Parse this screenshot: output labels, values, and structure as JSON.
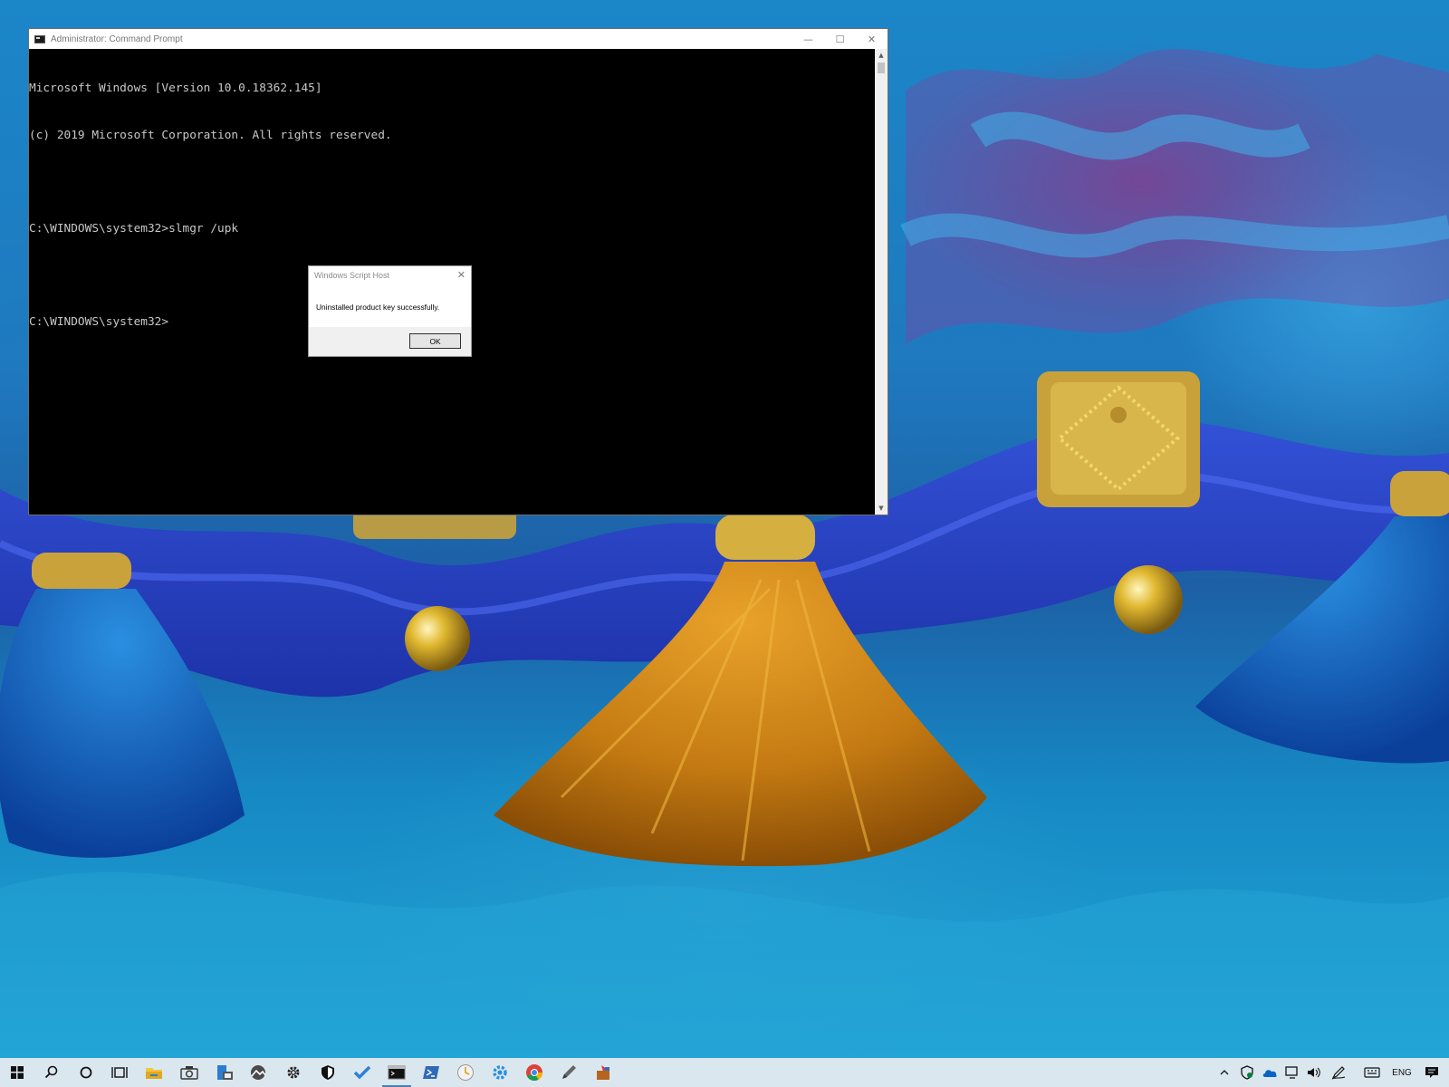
{
  "cmd_window": {
    "title": "Administrator: Command Prompt",
    "lines": [
      "Microsoft Windows [Version 10.0.18362.145]",
      "(c) 2019 Microsoft Corporation. All rights reserved.",
      "",
      "C:\\WINDOWS\\system32>slmgr /upk",
      "",
      "C:\\WINDOWS\\system32>"
    ],
    "minimize_glyph": "—",
    "maximize_glyph": "☐",
    "close_glyph": "✕"
  },
  "dialog": {
    "title": "Windows Script Host",
    "message": "Uninstalled product key successfully.",
    "ok_label": "OK",
    "close_glyph": "✕"
  },
  "taskbar": {
    "pinned": [
      {
        "name": "start-icon",
        "active": false
      },
      {
        "name": "search-icon",
        "active": false
      },
      {
        "name": "cortana-icon",
        "active": false
      },
      {
        "name": "task-view-icon",
        "active": false
      },
      {
        "name": "file-explorer-icon",
        "active": false
      },
      {
        "name": "camera-icon",
        "active": false
      },
      {
        "name": "office-icon",
        "active": false
      },
      {
        "name": "photos-icon",
        "active": false
      },
      {
        "name": "settings-icon",
        "active": false
      },
      {
        "name": "security-icon",
        "active": false
      },
      {
        "name": "todo-icon",
        "active": false
      },
      {
        "name": "command-prompt-icon",
        "active": true
      },
      {
        "name": "powershell-icon",
        "active": false
      },
      {
        "name": "clock-app-icon",
        "active": false
      },
      {
        "name": "gear-app-icon",
        "active": false
      },
      {
        "name": "chrome-icon",
        "active": false
      },
      {
        "name": "pen-icon",
        "active": false
      },
      {
        "name": "package-icon",
        "active": false
      }
    ],
    "tray": {
      "language": "ENG",
      "chevron": "^"
    }
  },
  "colors": {
    "taskbar_bg": "#dbe7ef",
    "console_bg": "#000000",
    "console_text": "#c8c8c8",
    "accent": "#0078d7"
  }
}
